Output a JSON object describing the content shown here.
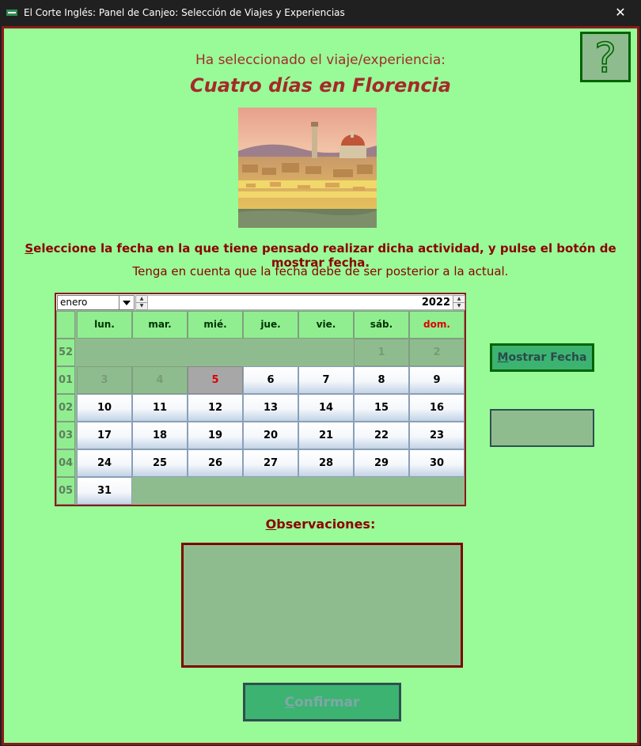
{
  "window": {
    "title": "El Corte Inglés: Panel de Canjeo: Selección de Viajes y Experiencias",
    "close_glyph": "✕"
  },
  "header": {
    "selected_prefix": "Ha seleccionado el viaje/experiencia:",
    "trip_name": "Cuatro días en Florencia"
  },
  "help": {
    "glyph": "?"
  },
  "instructions": {
    "line1_mnemonic": "S",
    "line1_rest": "eleccione la fecha en la que tiene pensado realizar dicha actividad, y pulse el botón de mostrar fecha.",
    "line2": "Tenga en cuenta que la fecha debe de ser posterior a la actual."
  },
  "calendar": {
    "month": "enero",
    "year": "2022",
    "day_names": [
      "lun.",
      "mar.",
      "mié.",
      "jue.",
      "vie.",
      "sáb.",
      "dom."
    ],
    "weeks": [
      {
        "num": "52",
        "days": [
          "",
          "",
          "",
          "",
          "",
          "1",
          "2"
        ],
        "states": [
          "blank",
          "blank",
          "blank",
          "blank",
          "blank",
          "other",
          "other"
        ]
      },
      {
        "num": "01",
        "days": [
          "3",
          "4",
          "5",
          "6",
          "7",
          "8",
          "9"
        ],
        "states": [
          "past",
          "past",
          "today",
          "normal",
          "normal",
          "normal",
          "normal"
        ]
      },
      {
        "num": "02",
        "days": [
          "10",
          "11",
          "12",
          "13",
          "14",
          "15",
          "16"
        ],
        "states": [
          "normal",
          "normal",
          "normal",
          "normal",
          "normal",
          "normal",
          "normal"
        ]
      },
      {
        "num": "03",
        "days": [
          "17",
          "18",
          "19",
          "20",
          "21",
          "22",
          "23"
        ],
        "states": [
          "normal",
          "normal",
          "normal",
          "normal",
          "normal",
          "normal",
          "normal"
        ]
      },
      {
        "num": "04",
        "days": [
          "24",
          "25",
          "26",
          "27",
          "28",
          "29",
          "30"
        ],
        "states": [
          "normal",
          "normal",
          "normal",
          "normal",
          "normal",
          "normal",
          "normal"
        ]
      },
      {
        "num": "05",
        "days": [
          "31",
          "",
          "",
          "",
          "",
          "",
          ""
        ],
        "states": [
          "normal",
          "blank",
          "blank",
          "blank",
          "blank",
          "blank",
          "blank"
        ]
      }
    ]
  },
  "buttons": {
    "show_date_mnemonic": "M",
    "show_date_rest": "ostrar Fecha",
    "confirm_mnemonic": "C",
    "confirm_rest": "onfirmar"
  },
  "date_output": {
    "value": ""
  },
  "observations": {
    "label_mnemonic": "O",
    "label_rest": "bservaciones:",
    "value": ""
  },
  "colors": {
    "accent_dark_red": "#8b1a1a",
    "background": "#98fb98",
    "button_green": "#3cb371",
    "panel_green": "#8fbc8f"
  }
}
